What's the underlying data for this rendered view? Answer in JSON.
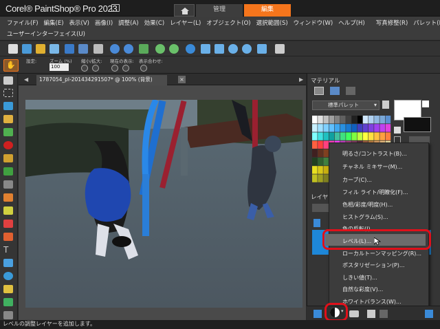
{
  "app": {
    "title": "Corel® PaintShop® Pro 2023",
    "tabs": {
      "manage": "管理",
      "edit": "編集"
    }
  },
  "menu": {
    "items": [
      "ファイル(F)",
      "編集(E)",
      "表示(V)",
      "画像(I)",
      "調整(A)",
      "効果(C)",
      "レイヤー(L)",
      "オブジェクト(O)",
      "選択範囲(S)",
      "ウィンドウ(W)",
      "ヘルプ(H)",
      "写真修整(R)",
      "パレット(P)"
    ],
    "second_row": "ユーザーインターフェイス(U)"
  },
  "options_bar": {
    "label_preset": "設定:",
    "label_zoom": "ズーム (%)",
    "zoom_value": "100",
    "label_zoom_inout": "縮小/拡大:",
    "label_actual": "現在の表示:",
    "label_fit": "表示合わせ:"
  },
  "document": {
    "tab_label": "1787054_pl-20143429150​7* @ 100% (背景)"
  },
  "materials": {
    "title": "マテリアル",
    "palette_select": "標準パレット"
  },
  "layers": {
    "title": "レイヤー"
  },
  "context_menu": {
    "items": [
      "明るさ/コントラスト(B)...",
      "チャネル ミキサー(M)...",
      "カーブ(C)...",
      "フィル ライト/明瞭化(F)...",
      "色相/彩度/明度(H)...",
      "ヒストグラム(S)...",
      "色の反転(I)...",
      "レベル(L)...",
      "ローカルトーンマッピング(R)...",
      "ポスタリゼーション(P)...",
      "しきい値(T)...",
      "自然な彩度(V)...",
      "ホワイトバランス(W)..."
    ],
    "highlighted_index": 7
  },
  "status": {
    "text": "レベルの調整レイヤーを追加します。"
  },
  "colors": {
    "accent": "#f5751c",
    "highlight_ring": "#e0101a",
    "layer_selected": "#1e87d8"
  }
}
